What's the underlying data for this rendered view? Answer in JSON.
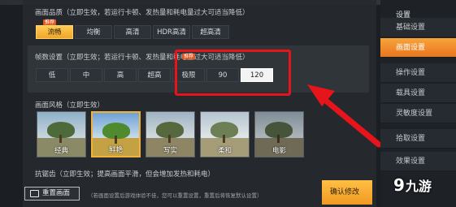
{
  "graphics_quality": {
    "title": "画面品质（立即生效，若运行卡顿、发热量和耗电量过大可适当降低）",
    "tag": "推荐",
    "options": [
      "流畅",
      "均衡",
      "高清",
      "HDR高清",
      "超高清"
    ],
    "selected": "流畅"
  },
  "frame_rate": {
    "title": "帧数设置（立即生效；若运行卡顿、发热量和耗电量过大可适当降低）",
    "tag": "推荐",
    "options": [
      "低",
      "中",
      "高",
      "超高",
      "极限",
      "90",
      "120"
    ],
    "selected": "120"
  },
  "style": {
    "title": "画面风格（立即生效）",
    "options": [
      "经典",
      "鲜艳",
      "写实",
      "柔和",
      "电影"
    ],
    "selected": "鲜艳"
  },
  "antialias": {
    "title": "抗锯齿（立即生效；提高画面平滑，但会增加发热和耗电）"
  },
  "footer": {
    "reset_label": "重置画面",
    "note": "（若画面设置后游戏体验不佳，您可以重置设置，重置后将恢复默认设置）",
    "confirm_label": "确认修改"
  },
  "sidebar": {
    "header": "设置",
    "items": [
      "基础设置",
      "画面设置",
      "操作设置",
      "载具设置",
      "灵敏度设置",
      "拾取设置",
      "效果设置"
    ],
    "active": "画面设置"
  },
  "watermark": {
    "nine": "9",
    "text": "九游"
  },
  "colors": {
    "accent": "#f0a42a",
    "highlight_box": "#e8141b",
    "tag": "#e4571f"
  }
}
